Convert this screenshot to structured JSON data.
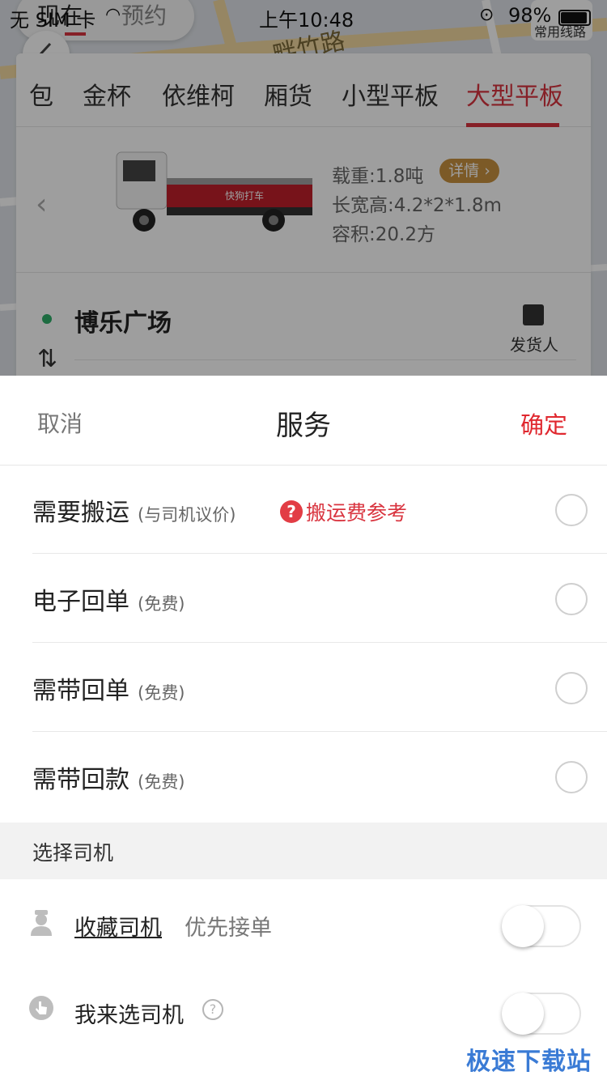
{
  "status_bar": {
    "carrier": "无 SIM 卡",
    "time": "上午10:48",
    "battery": "98%"
  },
  "top_tabs": {
    "now": "现在",
    "reserve": "预约"
  },
  "map": {
    "road_label": "畔竹路",
    "route_button": "常用线路"
  },
  "vehicle_tabs": [
    "包",
    "金杯",
    "依维柯",
    "厢货",
    "小型平板",
    "大型平板"
  ],
  "vehicle": {
    "brand_text": "快狗打车",
    "load": "载重:1.8吨",
    "detail_label": "详情 ›",
    "dimensions": "长宽高:4.2*2*1.8m",
    "volume": "容积:20.2方"
  },
  "route": {
    "start": "博乐广场",
    "sender": "发货人"
  },
  "sheet": {
    "cancel": "取消",
    "title": "服务",
    "confirm": "确定",
    "services": [
      {
        "name": "需要搬运",
        "note": "(与司机议价)"
      },
      {
        "name": "电子回单",
        "note": "(免费)"
      },
      {
        "name": "需带回单",
        "note": "(免费)"
      },
      {
        "name": "需带回款",
        "note": "(免费)"
      }
    ],
    "fee_reference": "搬运费参考",
    "driver_section": "选择司机",
    "favorite_driver": "收藏司机",
    "favorite_sub": "优先接单",
    "choose_driver": "我来选司机"
  },
  "watermark": "极速下载站",
  "colors": {
    "accent_red": "#d9343f",
    "confirm_red": "#e0282f",
    "badge_gold": "#c9923f",
    "start_green": "#2fae6a"
  }
}
